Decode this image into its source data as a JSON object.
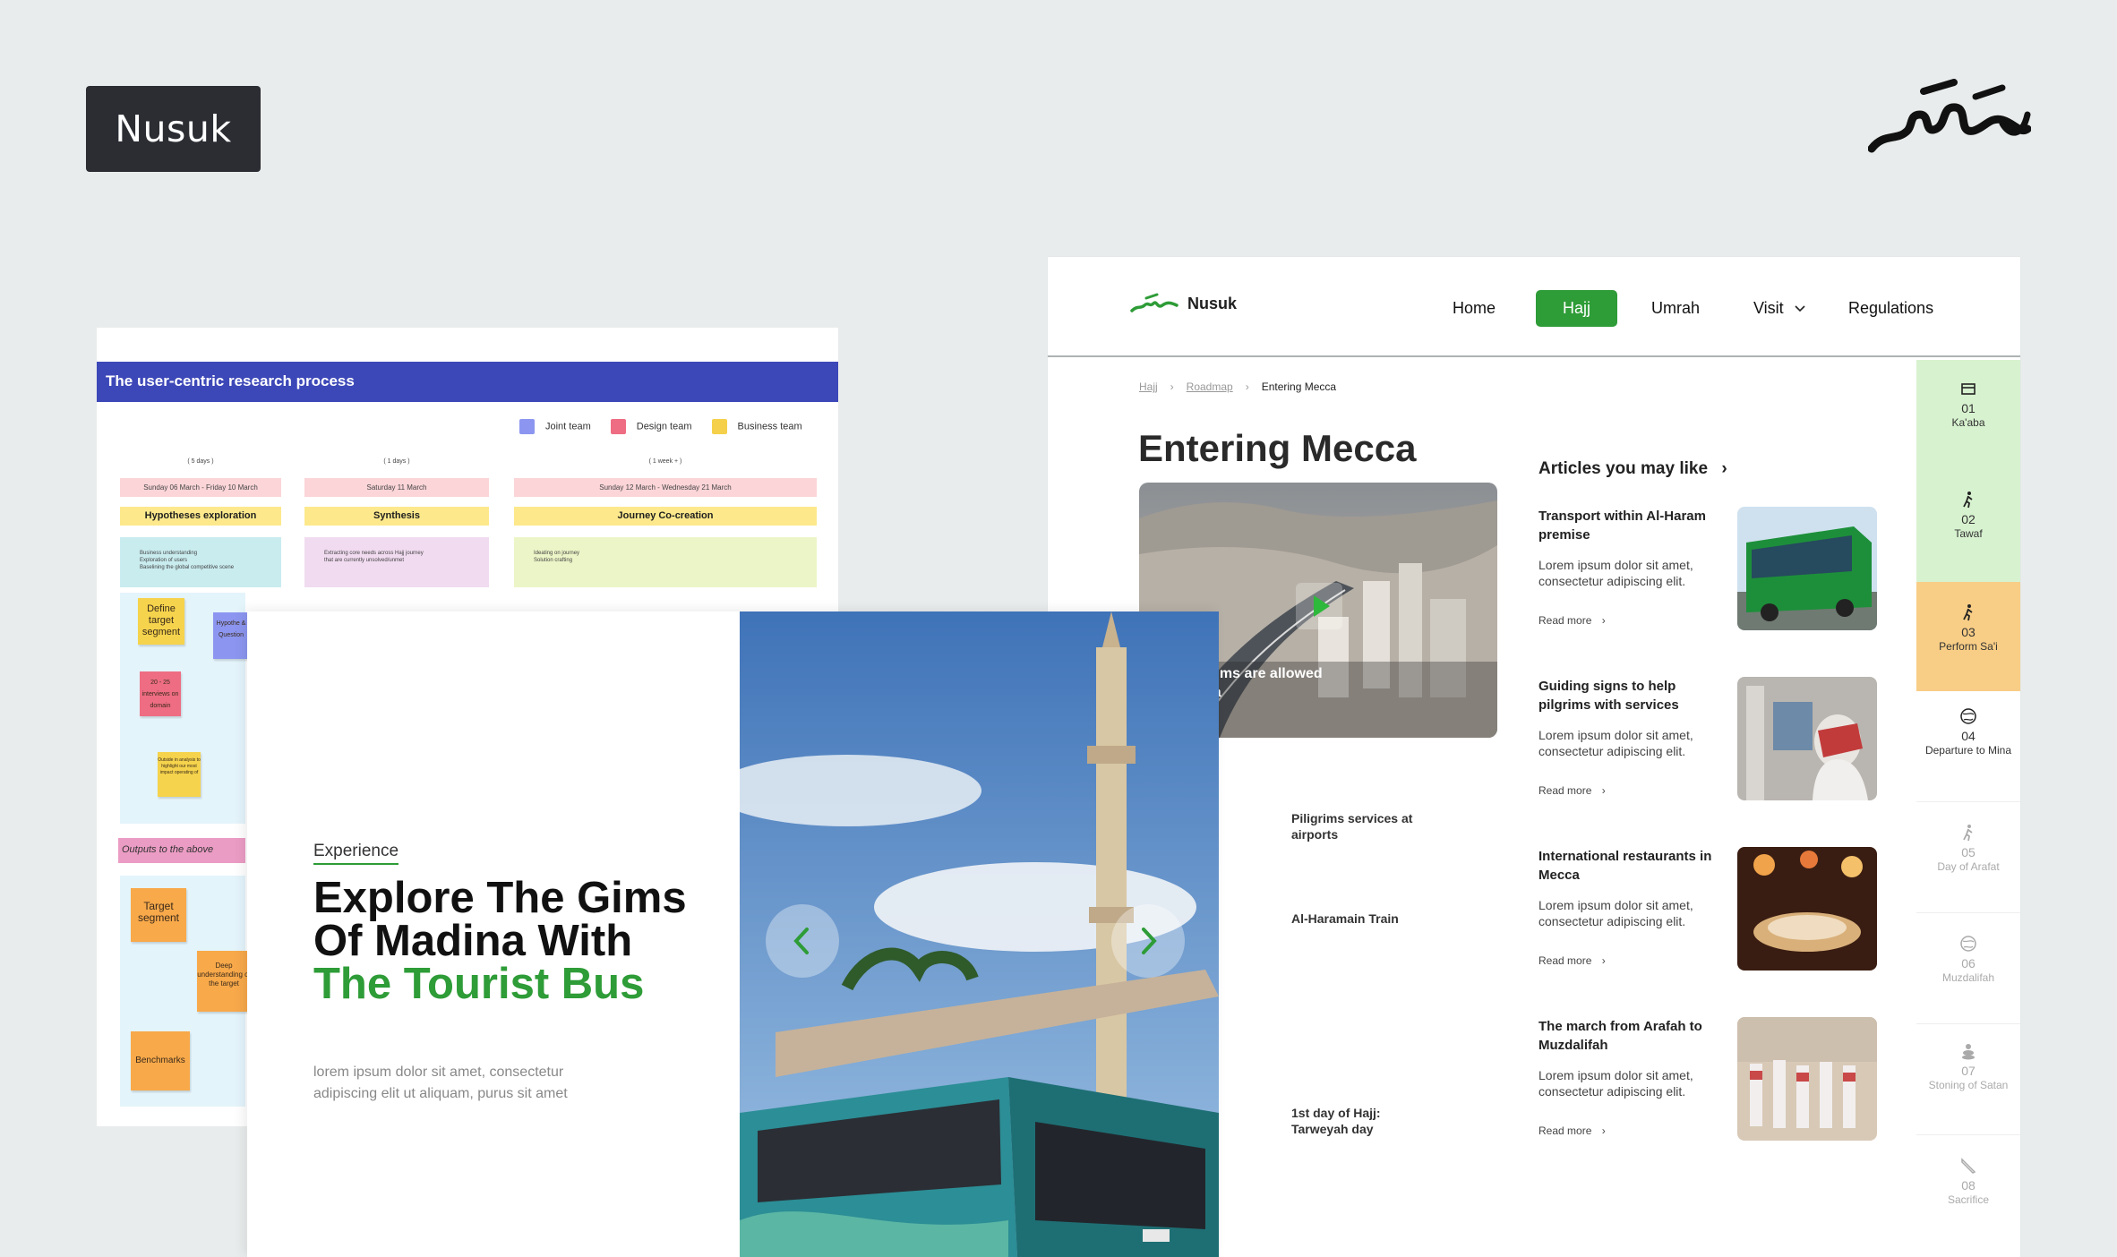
{
  "tag": {
    "label": "Nusuk"
  },
  "board": {
    "title": "The user-centric research process",
    "legend": [
      {
        "label": "Joint team",
        "color": "#8c96f0"
      },
      {
        "label": "Design team",
        "color": "#ee6d83"
      },
      {
        "label": "Business team",
        "color": "#f5d04a"
      }
    ],
    "columns": [
      {
        "duration": "( 5 days )",
        "dates": "Sunday 06 March - Friday 10 March",
        "phase": "Hypotheses exploration",
        "notes": [
          "Business understanding",
          "Exploration of users",
          "Baselining the global competitive scene"
        ]
      },
      {
        "duration": "( 1 days )",
        "dates": "Saturday 11 March",
        "phase": "Synthesis",
        "notes": [
          "Extracting core needs across Hajj journey",
          "that are currently unsolved/unmet"
        ]
      },
      {
        "duration": "( 1 week + )",
        "dates": "Sunday 12 March - Wednesday 21 March",
        "phase": "Journey Co-creation",
        "notes": [
          "Ideating on journey",
          "Solution crafting"
        ]
      }
    ],
    "stickies": {
      "define": "Define target segment",
      "hypo": "Hypothe & Question",
      "interviews": "20 - 25 interviews on domain",
      "outside": "Outside in analysis to highlight our most impact operating of",
      "outputs": "Outputs to the above",
      "target": "Target segment",
      "deep": "Deep understanding of the target",
      "bench": "Benchmarks"
    }
  },
  "web": {
    "brand": "Nusuk",
    "nav": {
      "home": "Home",
      "hajj": "Hajj",
      "umrah": "Umrah",
      "visit": "Visit",
      "regulations": "Regulations"
    },
    "breadcrumb": {
      "level1": "Hajj",
      "level2": "Roadmap",
      "current": "Entering Mecca"
    },
    "title": "Entering Mecca",
    "hero_caption": "lgrims are allowed\ncca",
    "side_list": [
      "Piligrims services at airports",
      "Al-Haramain Train",
      "1st day of Hajj: Tarweyah day"
    ],
    "articles_title": "Articles you may like",
    "articles": [
      {
        "title": "Transport within Al-Haram premise",
        "desc": "Lorem ipsum dolor sit amet, consectetur adipiscing elit.",
        "more": "Read more"
      },
      {
        "title": "Guiding signs to help pilgrims with services",
        "desc": "Lorem ipsum dolor sit amet, consectetur adipiscing elit.",
        "more": "Read more"
      },
      {
        "title": "International restaurants in Mecca",
        "desc": "Lorem ipsum dolor sit amet, consectetur adipiscing elit.",
        "more": "Read more"
      },
      {
        "title": "The march from Arafah to Muzdalifah",
        "desc": "Lorem ipsum dolor sit amet, consectetur adipiscing elit.",
        "more": "Read more"
      }
    ],
    "steps": [
      {
        "num": "01",
        "label": "Ka'aba",
        "state": "done"
      },
      {
        "num": "02",
        "label": "Tawaf",
        "state": "done"
      },
      {
        "num": "03",
        "label": "Perform Sa'i",
        "state": "current"
      },
      {
        "num": "04",
        "label": "Departure to Mina",
        "state": "next"
      },
      {
        "num": "05",
        "label": "Day of Arafat",
        "state": "upcoming"
      },
      {
        "num": "06",
        "label": "Muzdalifah",
        "state": "upcoming"
      },
      {
        "num": "07",
        "label": "Stoning of Satan",
        "state": "upcoming"
      },
      {
        "num": "08",
        "label": "Sacrifice",
        "state": "upcoming"
      }
    ]
  },
  "card": {
    "eyebrow": "Experience",
    "headline_a": "Explore The Gims Of Madina With ",
    "headline_b": "The Tourist Bus",
    "sub": "lorem ipsum dolor sit amet, consectetur adipiscing elit ut aliquam, purus sit amet"
  },
  "colors": {
    "brand_green": "#2e9c37",
    "done_step": "#d7f2cf",
    "current_step": "#f8cd85",
    "board_header": "#3d48b8"
  }
}
